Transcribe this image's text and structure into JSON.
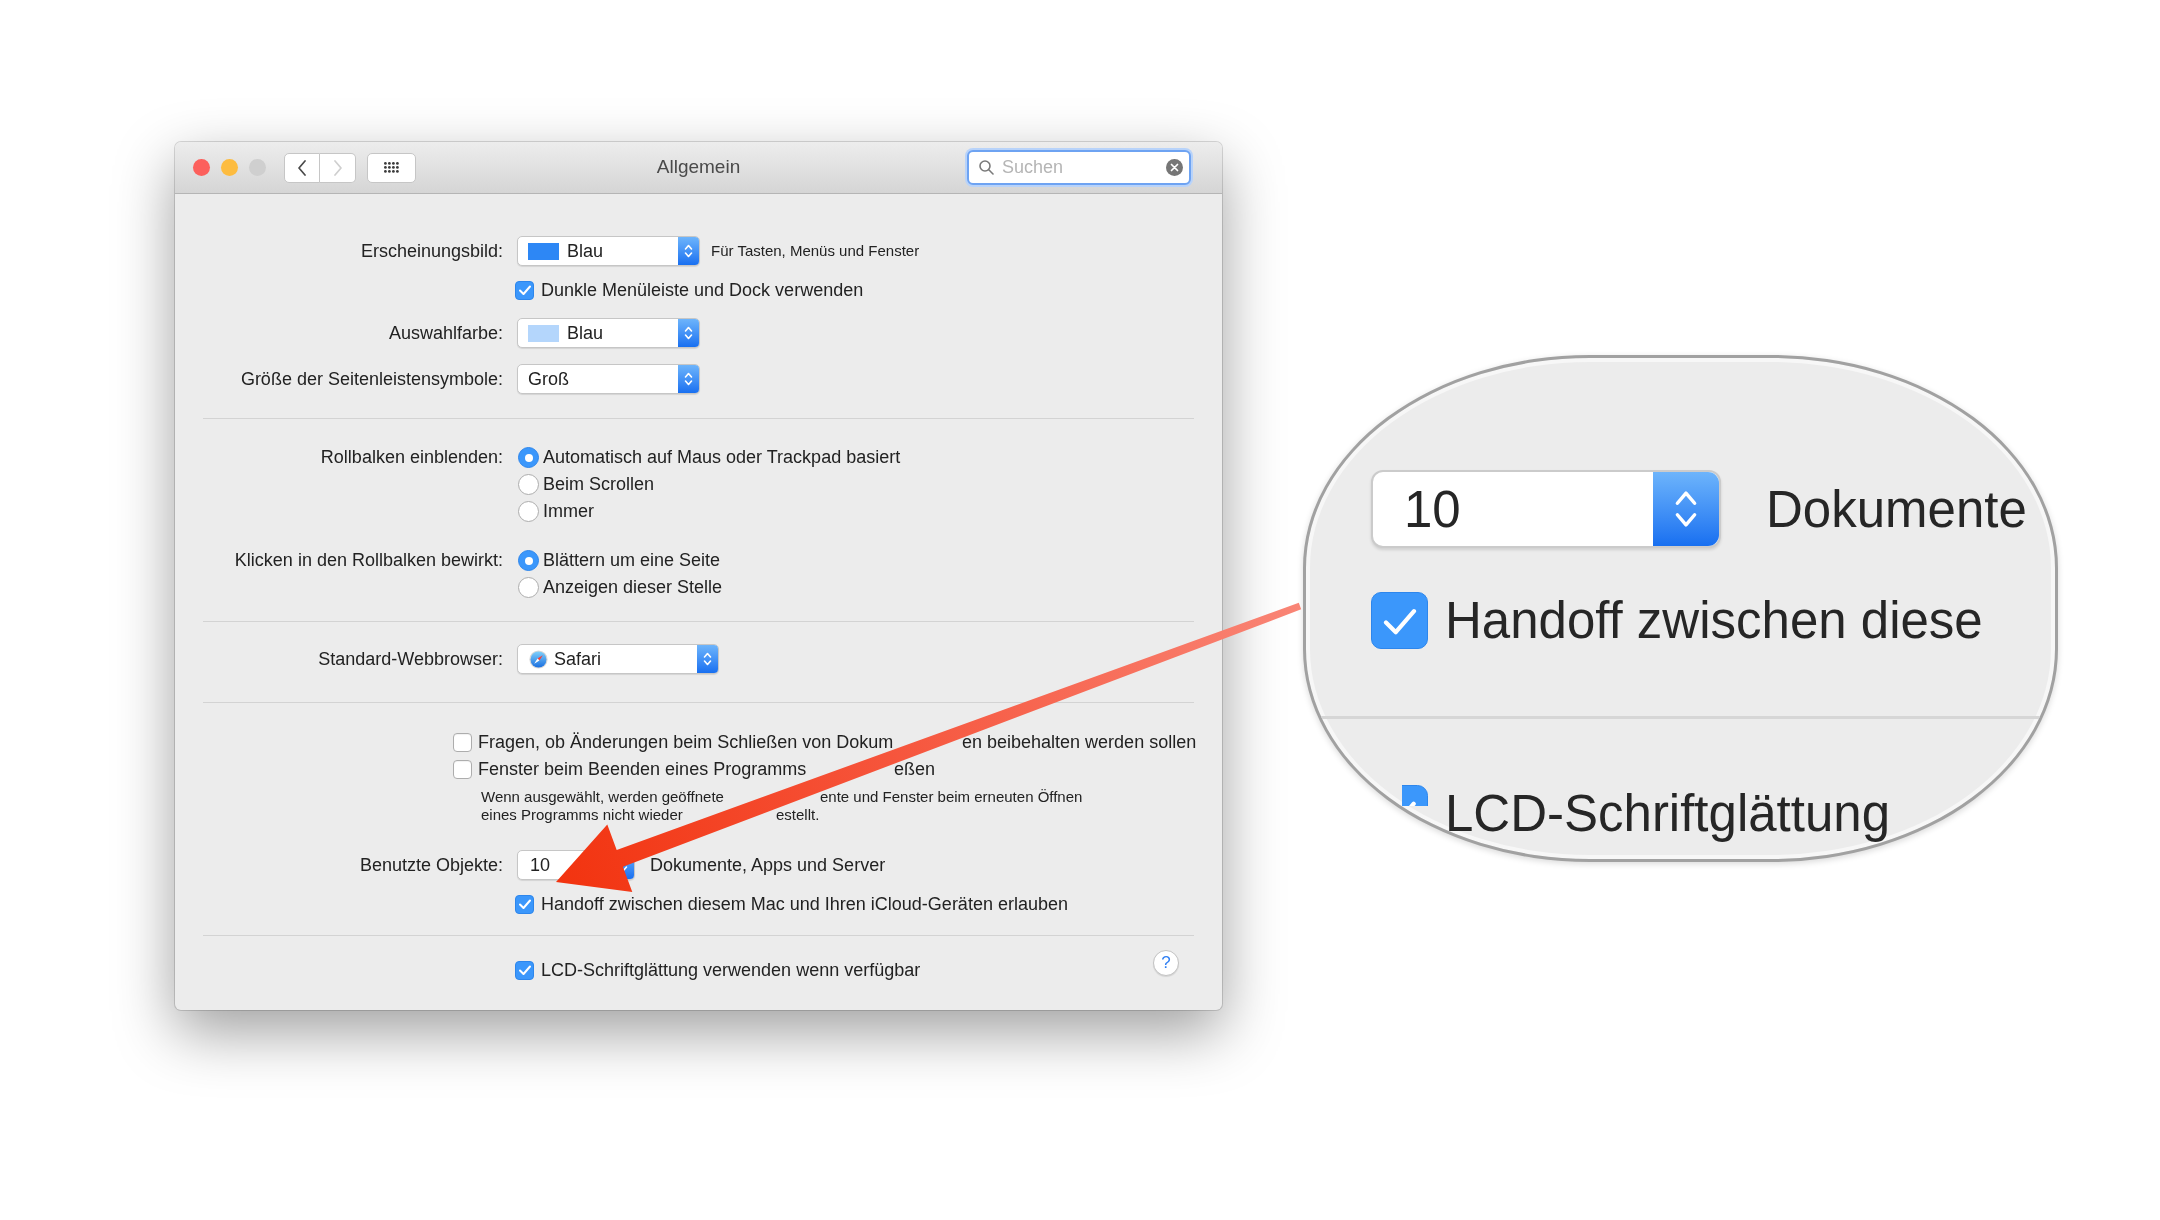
{
  "window": {
    "title": "Allgemein",
    "traffic_lights": [
      {
        "color": "#fc605c"
      },
      {
        "color": "#fdbc40"
      },
      {
        "color": "#cfcfcf"
      }
    ],
    "nav_buttons": [
      {
        "kind": "back",
        "disabled": false
      },
      {
        "kind": "forward",
        "disabled": true
      }
    ],
    "search": {
      "placeholder": "Suchen"
    }
  },
  "sections": [
    {
      "rows": [
        {
          "kind": "popup",
          "label": "Erscheinungsbild:",
          "value": "Blau",
          "color": "#2d87f5",
          "note": "Für Tasten, Menüs und Fenster"
        },
        {
          "kind": "checkbox",
          "label": "Dunkle Menüleiste und Dock verwenden",
          "checked": true
        },
        {
          "kind": "popup",
          "label": "Auswahlfarbe:",
          "value": "Blau",
          "color": "#b4d6fc"
        },
        {
          "kind": "popup",
          "label": "Größe der Seitenleistensymbole:",
          "value": "Groß"
        }
      ]
    },
    {
      "rows": [
        {
          "kind": "radios",
          "label": "Rollbalken einblenden:",
          "options": [
            {
              "label": "Automatisch auf Maus oder Trackpad basiert",
              "selected": true
            },
            {
              "label": "Beim Scrollen",
              "selected": false
            },
            {
              "label": "Immer",
              "selected": false
            }
          ]
        },
        {
          "kind": "radios",
          "label": "Klicken in den Rollbalken bewirkt:",
          "options": [
            {
              "label": "Blättern um eine Seite",
              "selected": true
            },
            {
              "label": "Anzeigen dieser Stelle",
              "selected": false
            }
          ]
        }
      ]
    },
    {
      "rows": [
        {
          "kind": "browser",
          "label": "Standard-Webbrowser:",
          "value": "Safari"
        }
      ]
    },
    {
      "rows": [
        {
          "kind": "option",
          "label_parts": [
            "Fragen, ob Änderungen beim Schließen von Dokum",
            "en beibehalten werden sollen"
          ],
          "checked": false
        },
        {
          "kind": "option",
          "label_parts": [
            "Fenster beim Beenden eines Programms",
            "eßen"
          ],
          "checked": false,
          "hint_lines": [
            [
              "Wenn ausgewählt, werden geöffnete",
              "ente und Fenster beim erneuten Öffnen"
            ],
            [
              "eines Programms nicht wieder",
              "estellt."
            ]
          ]
        },
        {
          "kind": "combo",
          "label": "Benutzte Objekte:",
          "value": "10",
          "note": "Dokumente, Apps und Server"
        },
        {
          "kind": "checkbox",
          "label": "Handoff zwischen diesem Mac und Ihren iCloud-Geräten erlauben",
          "checked": true
        }
      ]
    },
    {
      "rows": [
        {
          "kind": "checkbox",
          "label": "LCD-Schriftglättung verwenden wenn verfügbar",
          "checked": true
        }
      ],
      "help": "?"
    }
  ],
  "magnifier": {
    "combo": {
      "value": "10",
      "note": "Dokumente"
    },
    "checkboxes": [
      {
        "label": "Handoff zwischen diese",
        "checked": true
      },
      {
        "label": "LCD-Schriftglättung",
        "checked": true
      }
    ]
  }
}
